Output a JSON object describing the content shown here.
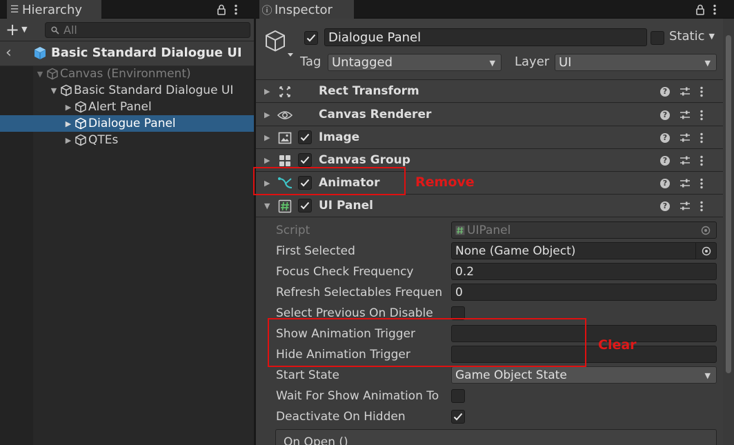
{
  "hierarchy": {
    "tab_label": "Hierarchy",
    "search_placeholder": "All",
    "prefab_title": "Basic Standard Dialogue UI",
    "tree": [
      {
        "label": "Canvas (Environment)"
      },
      {
        "label": "Basic Standard Dialogue UI"
      },
      {
        "label": "Alert Panel"
      },
      {
        "label": "Dialogue Panel"
      },
      {
        "label": "QTEs"
      }
    ]
  },
  "inspector": {
    "tab_label": "Inspector",
    "object_name": "Dialogue Panel",
    "static_label": "Static",
    "tag_label": "Tag",
    "tag_value": "Untagged",
    "layer_label": "Layer",
    "layer_value": "UI",
    "components": [
      {
        "name": "Rect Transform",
        "icon": "rect-transform-icon"
      },
      {
        "name": "Canvas Renderer",
        "icon": "eye-icon"
      },
      {
        "name": "Image",
        "icon": "image-icon"
      },
      {
        "name": "Canvas Group",
        "icon": "grid-icon"
      },
      {
        "name": "Animator",
        "icon": "animator-icon"
      },
      {
        "name": "UI Panel",
        "icon": "script-icon"
      }
    ],
    "properties": {
      "script_label": "Script",
      "script_value": "UIPanel",
      "first_selected_label": "First Selected",
      "first_selected_value": "None (Game Object)",
      "focus_check_label": "Focus Check Frequency",
      "focus_check_value": "0.2",
      "refresh_label": "Refresh Selectables Frequen",
      "refresh_value": "0",
      "select_prev_label": "Select Previous On Disable",
      "show_trigger_label": "Show Animation Trigger",
      "show_trigger_value": "",
      "hide_trigger_label": "Hide Animation Trigger",
      "hide_trigger_value": "",
      "start_state_label": "Start State",
      "start_state_value": "Game Object State",
      "wait_show_label": "Wait For Show Animation To",
      "deactivate_label": "Deactivate On Hidden",
      "on_open_label": "On Open ()"
    }
  },
  "annotations": {
    "remove": "Remove",
    "clear": "Clear"
  },
  "colors": {
    "selection": "#2c5d87",
    "annotation": "#e01010",
    "panel": "#3c3c3c"
  }
}
